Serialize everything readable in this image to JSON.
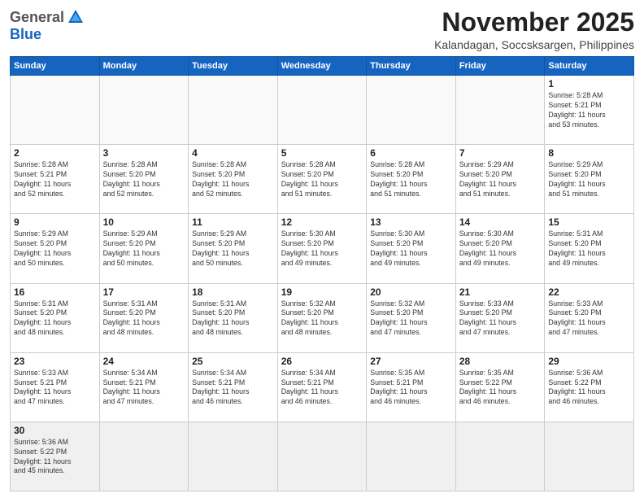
{
  "header": {
    "logo_general": "General",
    "logo_blue": "Blue",
    "month_title": "November 2025",
    "location": "Kalandagan, Soccsksargen, Philippines"
  },
  "weekdays": [
    "Sunday",
    "Monday",
    "Tuesday",
    "Wednesday",
    "Thursday",
    "Friday",
    "Saturday"
  ],
  "weeks": [
    [
      {
        "day": "",
        "info": ""
      },
      {
        "day": "",
        "info": ""
      },
      {
        "day": "",
        "info": ""
      },
      {
        "day": "",
        "info": ""
      },
      {
        "day": "",
        "info": ""
      },
      {
        "day": "",
        "info": ""
      },
      {
        "day": "1",
        "info": "Sunrise: 5:28 AM\nSunset: 5:21 PM\nDaylight: 11 hours\nand 53 minutes."
      }
    ],
    [
      {
        "day": "2",
        "info": "Sunrise: 5:28 AM\nSunset: 5:21 PM\nDaylight: 11 hours\nand 52 minutes."
      },
      {
        "day": "3",
        "info": "Sunrise: 5:28 AM\nSunset: 5:20 PM\nDaylight: 11 hours\nand 52 minutes."
      },
      {
        "day": "4",
        "info": "Sunrise: 5:28 AM\nSunset: 5:20 PM\nDaylight: 11 hours\nand 52 minutes."
      },
      {
        "day": "5",
        "info": "Sunrise: 5:28 AM\nSunset: 5:20 PM\nDaylight: 11 hours\nand 51 minutes."
      },
      {
        "day": "6",
        "info": "Sunrise: 5:28 AM\nSunset: 5:20 PM\nDaylight: 11 hours\nand 51 minutes."
      },
      {
        "day": "7",
        "info": "Sunrise: 5:29 AM\nSunset: 5:20 PM\nDaylight: 11 hours\nand 51 minutes."
      },
      {
        "day": "8",
        "info": "Sunrise: 5:29 AM\nSunset: 5:20 PM\nDaylight: 11 hours\nand 51 minutes."
      }
    ],
    [
      {
        "day": "9",
        "info": "Sunrise: 5:29 AM\nSunset: 5:20 PM\nDaylight: 11 hours\nand 50 minutes."
      },
      {
        "day": "10",
        "info": "Sunrise: 5:29 AM\nSunset: 5:20 PM\nDaylight: 11 hours\nand 50 minutes."
      },
      {
        "day": "11",
        "info": "Sunrise: 5:29 AM\nSunset: 5:20 PM\nDaylight: 11 hours\nand 50 minutes."
      },
      {
        "day": "12",
        "info": "Sunrise: 5:30 AM\nSunset: 5:20 PM\nDaylight: 11 hours\nand 49 minutes."
      },
      {
        "day": "13",
        "info": "Sunrise: 5:30 AM\nSunset: 5:20 PM\nDaylight: 11 hours\nand 49 minutes."
      },
      {
        "day": "14",
        "info": "Sunrise: 5:30 AM\nSunset: 5:20 PM\nDaylight: 11 hours\nand 49 minutes."
      },
      {
        "day": "15",
        "info": "Sunrise: 5:31 AM\nSunset: 5:20 PM\nDaylight: 11 hours\nand 49 minutes."
      }
    ],
    [
      {
        "day": "16",
        "info": "Sunrise: 5:31 AM\nSunset: 5:20 PM\nDaylight: 11 hours\nand 48 minutes."
      },
      {
        "day": "17",
        "info": "Sunrise: 5:31 AM\nSunset: 5:20 PM\nDaylight: 11 hours\nand 48 minutes."
      },
      {
        "day": "18",
        "info": "Sunrise: 5:31 AM\nSunset: 5:20 PM\nDaylight: 11 hours\nand 48 minutes."
      },
      {
        "day": "19",
        "info": "Sunrise: 5:32 AM\nSunset: 5:20 PM\nDaylight: 11 hours\nand 48 minutes."
      },
      {
        "day": "20",
        "info": "Sunrise: 5:32 AM\nSunset: 5:20 PM\nDaylight: 11 hours\nand 47 minutes."
      },
      {
        "day": "21",
        "info": "Sunrise: 5:33 AM\nSunset: 5:20 PM\nDaylight: 11 hours\nand 47 minutes."
      },
      {
        "day": "22",
        "info": "Sunrise: 5:33 AM\nSunset: 5:20 PM\nDaylight: 11 hours\nand 47 minutes."
      }
    ],
    [
      {
        "day": "23",
        "info": "Sunrise: 5:33 AM\nSunset: 5:21 PM\nDaylight: 11 hours\nand 47 minutes."
      },
      {
        "day": "24",
        "info": "Sunrise: 5:34 AM\nSunset: 5:21 PM\nDaylight: 11 hours\nand 47 minutes."
      },
      {
        "day": "25",
        "info": "Sunrise: 5:34 AM\nSunset: 5:21 PM\nDaylight: 11 hours\nand 46 minutes."
      },
      {
        "day": "26",
        "info": "Sunrise: 5:34 AM\nSunset: 5:21 PM\nDaylight: 11 hours\nand 46 minutes."
      },
      {
        "day": "27",
        "info": "Sunrise: 5:35 AM\nSunset: 5:21 PM\nDaylight: 11 hours\nand 46 minutes."
      },
      {
        "day": "28",
        "info": "Sunrise: 5:35 AM\nSunset: 5:22 PM\nDaylight: 11 hours\nand 46 minutes."
      },
      {
        "day": "29",
        "info": "Sunrise: 5:36 AM\nSunset: 5:22 PM\nDaylight: 11 hours\nand 46 minutes."
      }
    ],
    [
      {
        "day": "30",
        "info": "Sunrise: 5:36 AM\nSunset: 5:22 PM\nDaylight: 11 hours\nand 45 minutes."
      },
      {
        "day": "",
        "info": ""
      },
      {
        "day": "",
        "info": ""
      },
      {
        "day": "",
        "info": ""
      },
      {
        "day": "",
        "info": ""
      },
      {
        "day": "",
        "info": ""
      },
      {
        "day": "",
        "info": ""
      }
    ]
  ]
}
